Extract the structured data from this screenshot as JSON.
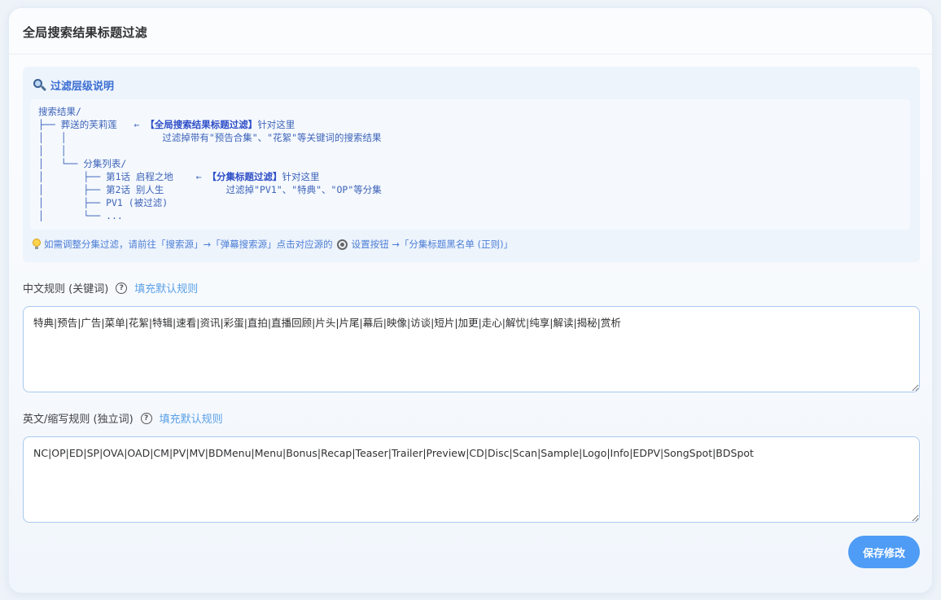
{
  "card": {
    "title": "全局搜索结果标题过滤"
  },
  "info": {
    "title": "过滤层级说明",
    "tree": {
      "l1": "搜索结果/",
      "l2a": "├── 葬送的芙莉莲   ← ",
      "l2b": "【全局搜索结果标题过滤】",
      "l2c": "针对这里",
      "l3": "│   │                 过滤掉带有\"预告合集\"、\"花絮\"等关键词的搜索结果",
      "l4": "│   │",
      "l5": "│   └── 分集列表/",
      "l6a": "│       ├── 第1话 启程之地    ← ",
      "l6b": "【分集标题过滤】",
      "l6c": "针对这里",
      "l7": "│       ├── 第2话 别人生           过滤掉\"PV1\"、\"特典\"、\"OP\"等分集",
      "l8": "│       ├── PV1 (被过滤)",
      "l9": "│       └── ..."
    },
    "tip_before": "如需调整分集过滤，请前往「搜索源」→「弹幕搜索源」点击对应源的",
    "tip_after": "设置按钮 →「分集标题黑名单 (正则)」"
  },
  "cn_rules": {
    "label": "中文规则 (关键词)",
    "fill_label": "填充默认规则",
    "value": "特典|预告|广告|菜单|花絮|特辑|速看|资讯|彩蛋|直拍|直播回顾|片头|片尾|幕后|映像|访谈|短片|加更|走心|解忧|纯享|解读|揭秘|赏析"
  },
  "en_rules": {
    "label": "英文/缩写规则 (独立词)",
    "fill_label": "填充默认规则",
    "value": "NC|OP|ED|SP|OVA|OAD|CM|PV|MV|BDMenu|Menu|Bonus|Recap|Teaser|Trailer|Preview|CD|Disc|Scan|Sample|Logo|Info|EDPV|SongSpot|BDSpot"
  },
  "save_label": "保存修改"
}
